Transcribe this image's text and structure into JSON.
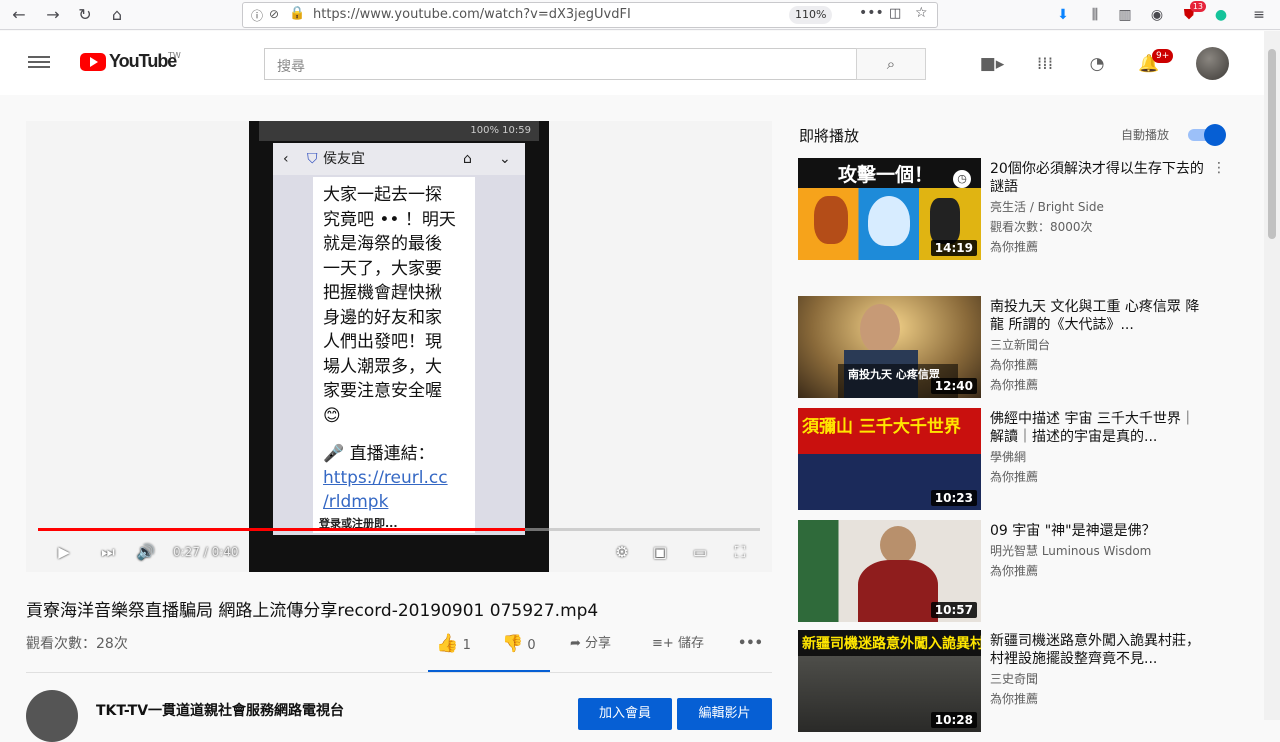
{
  "browser": {
    "url": "https://www.youtube.com/watch?v=dX3jegUvdFI",
    "zoom": "110%",
    "addon_badge": "13"
  },
  "header": {
    "logo_text": "YouTube",
    "logo_region": "TW",
    "search_placeholder": "搜尋",
    "notifications_badge": "9+"
  },
  "player": {
    "phone_status": "100% 10:59",
    "phone_chat_name": "侯友宜",
    "message_lines": [
      "大家一起去一探",
      "究竟吧 •• ！明天",
      "就是海祭的最後",
      "一天了，大家要",
      "把握機會趕快揪",
      "身邊的好友和家",
      "人們出發吧！現",
      "場人潮眾多，大",
      "家要注意安全喔"
    ],
    "emoji": "😊",
    "live_label": "直播連結：",
    "link_lines": [
      "https://reurl.cc",
      "/rldmpk"
    ],
    "signup_text": "登录或注册即...",
    "time": "0:27 / 0:40",
    "progress": 0.675
  },
  "video": {
    "title": "貢寮海洋音樂祭直播騙局 網路上流傳分享record-20190901 075927.mp4",
    "views": "觀看次數：28次",
    "like_count": "1",
    "dislike_count": "0",
    "share_label": "分享",
    "save_label": "儲存",
    "more_label": "•••"
  },
  "channel": {
    "name": "TKT-TV一貫道道親社會服務網路電視台",
    "join_label": "加入會員",
    "edit_label": "編輯影片"
  },
  "sidebar": {
    "up_next_label": "即將播放",
    "autoplay_label": "自動播放",
    "autoplay_on": true,
    "items": [
      {
        "title": "20個你必須解決才得以生存下去的謎語",
        "channel": "亮生活 / Bright Side",
        "meta": "觀看次數：8000次",
        "meta2": "為你推薦",
        "duration": "14:19",
        "thumb_text": "攻擊一個！"
      },
      {
        "title": "南投九天 文化與工重 心疼信眾 降龍 所謂的《大代誌》...",
        "channel": "三立新聞台",
        "meta": "為你推薦",
        "meta2": "為你推薦",
        "duration": "12:40",
        "thumb_text": "南投九天 心疼信眾"
      },
      {
        "title": "佛經中描述 宇宙 三千大千世界｜解讀｜描述的宇宙是真的...",
        "channel": "學佛網",
        "meta": "為你推薦",
        "meta2": "",
        "duration": "10:23",
        "thumb_text": "須彌山 三千大千世界"
      },
      {
        "title": "09 宇宙 \"神\"是神還是佛？",
        "channel": "明光智慧 Luminous Wisdom",
        "meta": "為你推薦",
        "meta2": "",
        "duration": "10:57",
        "thumb_text": ""
      },
      {
        "title": "新疆司機迷路意外闖入詭異村莊，村裡設施擺設整齊竟不見...",
        "channel": "三史奇聞",
        "meta": "為你推薦",
        "meta2": "",
        "duration": "10:28",
        "thumb_text": "新疆司機迷路意外闖入詭異村莊"
      }
    ]
  },
  "colors": {
    "youtube_red": "#ff0000",
    "link_blue": "#065fd4"
  }
}
